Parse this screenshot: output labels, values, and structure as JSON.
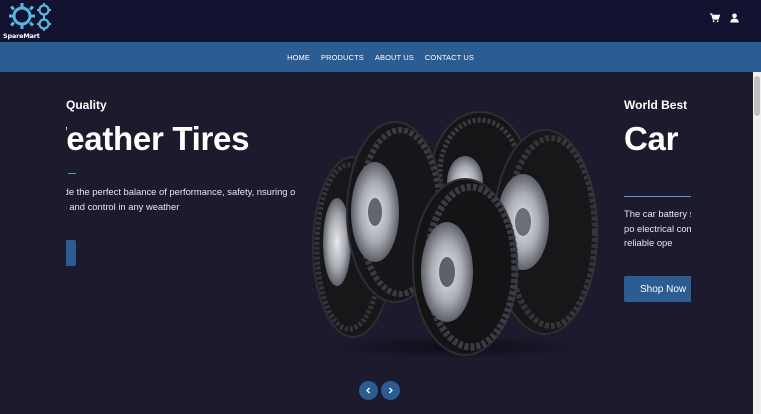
{
  "brand": {
    "name": "SpareMart"
  },
  "header": {
    "icons": [
      "cart-icon",
      "user-icon"
    ]
  },
  "nav": {
    "items": [
      "HOME",
      "PRODUCTS",
      "ABOUT US",
      "CONTACT US"
    ]
  },
  "slides": [
    {
      "small_title": "Quality",
      "big_title": "Weather Tires",
      "description": "s provide the perfect balance of performance, safety, nsuring optimal traction and control in any weather",
      "button": ""
    },
    {
      "small_title": "World Best (",
      "big_title": "Car",
      "description": "The car battery supplying the po electrical compo and reliable ope",
      "button": "Shop Now"
    }
  ],
  "carousel": {
    "prev_icon": "chevron-left-icon",
    "next_icon": "chevron-right-icon"
  },
  "colors": {
    "topbar": "#121331",
    "navbar": "#2b5d93",
    "hero": "#1c1a2d",
    "accent": "#5a9ad5"
  }
}
